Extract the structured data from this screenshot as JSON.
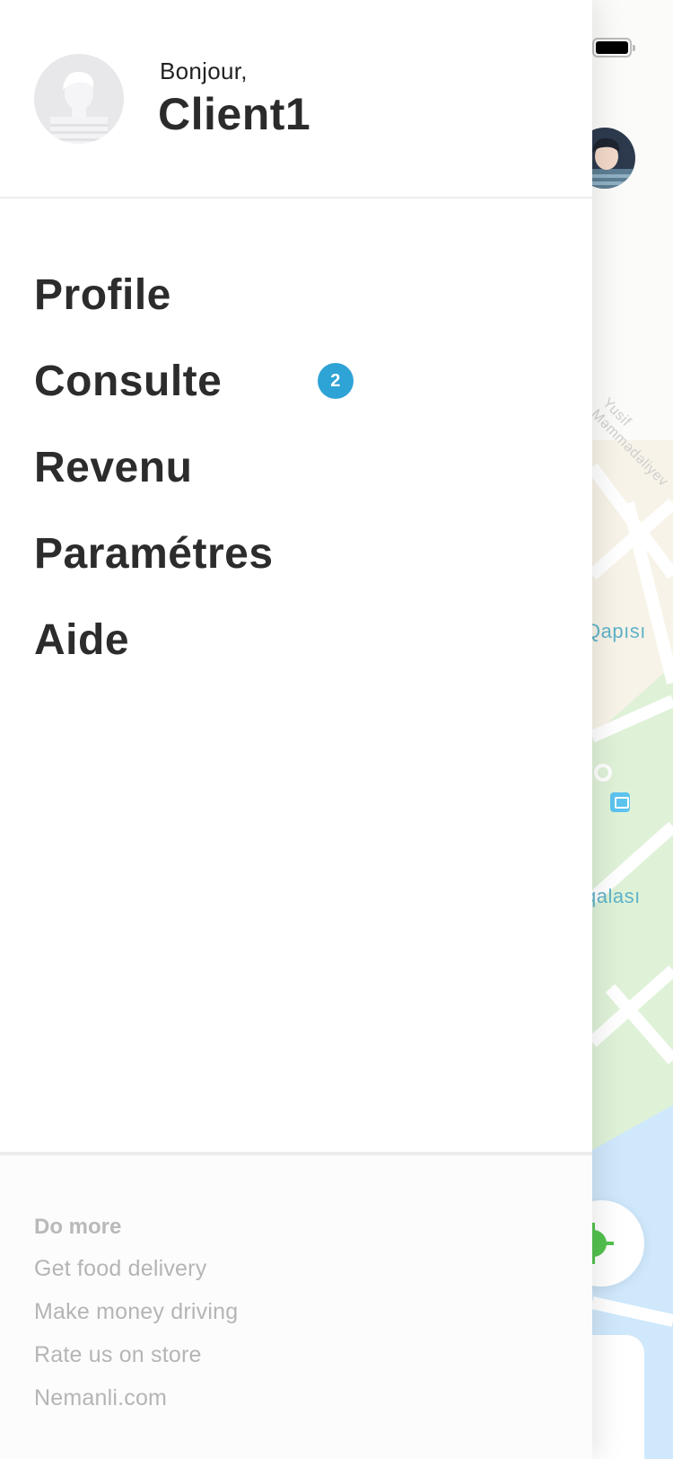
{
  "status_bar": {
    "battery_icon": "battery-icon"
  },
  "map": {
    "labels": [
      "Qapısı",
      "qalası",
      "Yusif Məmmədəliyev"
    ],
    "colors": {
      "land": "#f7f6f3",
      "park": "#dff2d8",
      "water": "#cfe8fb",
      "road": "#ffffff",
      "label": "#5fb3c9"
    }
  },
  "drawer": {
    "greeting": "Bonjour,",
    "username": "Client1",
    "menu": [
      {
        "label": "Profile"
      },
      {
        "label": "Consulte",
        "badge": "2"
      },
      {
        "label": "Revenu"
      },
      {
        "label": "Paramétres"
      },
      {
        "label": "Aide"
      }
    ],
    "footer": {
      "title": "Do more",
      "links": [
        "Get food delivery",
        "Make money driving",
        "Rate us on store",
        "Nemanli.com"
      ]
    }
  },
  "colors": {
    "badge": "#2ea3d6",
    "locate": "#53c24f",
    "text": "#2c2c2c",
    "muted": "#b5b5b5"
  }
}
